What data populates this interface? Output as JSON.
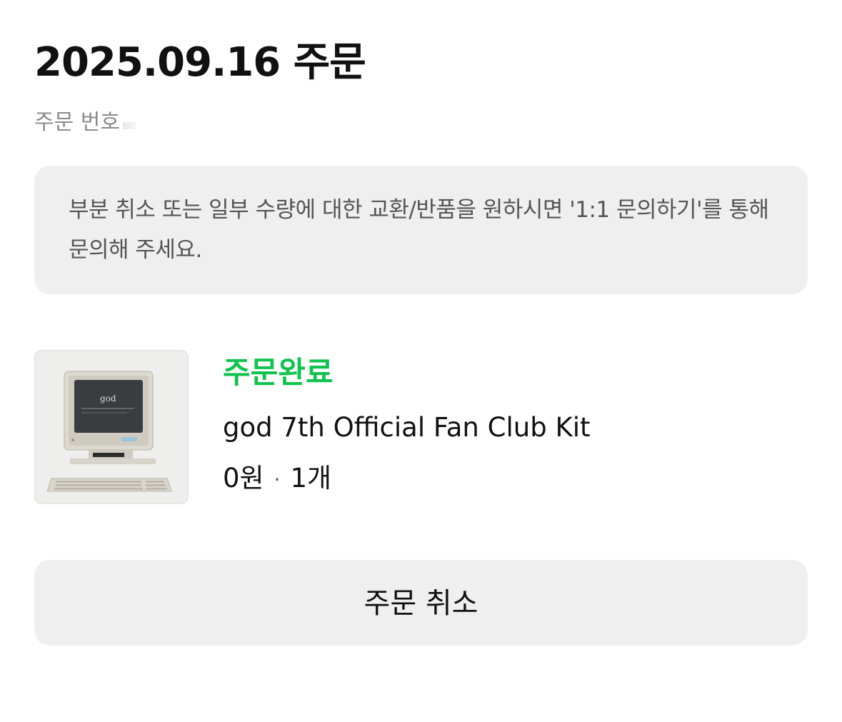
{
  "order": {
    "date_title": "2025.09.16 주문",
    "number_label": "주문 번호"
  },
  "notice": {
    "text": "부분 취소 또는 일부 수량에 대한 교환/반품을 원하시면 '1:1 문의하기'를 통해 문의해 주세요."
  },
  "item": {
    "status": "주문완료",
    "status_color": "#10c34e",
    "name": "god 7th Official Fan Club Kit",
    "price": "0원",
    "separator": "·",
    "quantity": "1개",
    "thumbnail_screen_text": "god"
  },
  "actions": {
    "cancel_label": "주문 취소"
  }
}
